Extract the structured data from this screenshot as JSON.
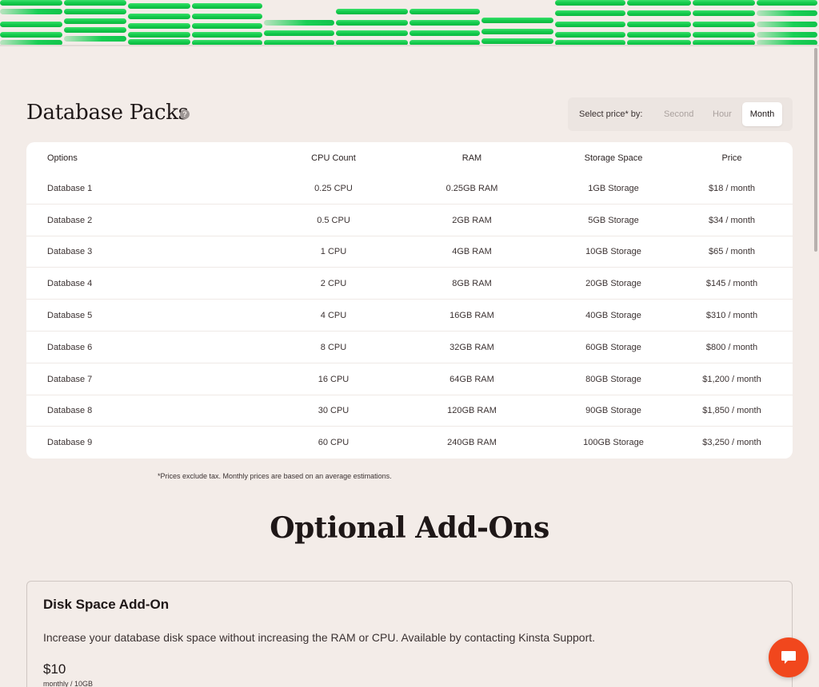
{
  "section": {
    "title": "Database Packs",
    "help_icon": "question-icon",
    "price_toggle": {
      "label": "Select price* by:",
      "options": [
        "Second",
        "Hour",
        "Month"
      ],
      "selected": "Month"
    }
  },
  "table": {
    "headers": [
      "Options",
      "CPU Count",
      "RAM",
      "Storage Space",
      "Price"
    ],
    "rows": [
      [
        "Database 1",
        "0.25 CPU",
        "0.25GB RAM",
        "1GB Storage",
        "$18 / month"
      ],
      [
        "Database 2",
        "0.5 CPU",
        "2GB RAM",
        "5GB Storage",
        "$34 / month"
      ],
      [
        "Database 3",
        "1 CPU",
        "4GB RAM",
        "10GB Storage",
        "$65 / month"
      ],
      [
        "Database 4",
        "2 CPU",
        "8GB RAM",
        "20GB Storage",
        "$145 / month"
      ],
      [
        "Database 5",
        "4 CPU",
        "16GB RAM",
        "40GB Storage",
        "$310 / month"
      ],
      [
        "Database 6",
        "8 CPU",
        "32GB RAM",
        "60GB Storage",
        "$800 / month"
      ],
      [
        "Database 7",
        "16 CPU",
        "64GB RAM",
        "80GB Storage",
        "$1,200 / month"
      ],
      [
        "Database 8",
        "30 CPU",
        "120GB RAM",
        "90GB Storage",
        "$1,850 / month"
      ],
      [
        "Database 9",
        "60 CPU",
        "240GB RAM",
        "100GB Storage",
        "$3,250 / month"
      ]
    ]
  },
  "footnote": "*Prices exclude tax. Monthly prices are based on an average estimations.",
  "addons": {
    "title": "Optional Add-Ons",
    "disk_space": {
      "title": "Disk Space Add-On",
      "description": "Increase your database disk space without increasing the RAM or CPU. Available by contacting Kinsta Support.",
      "price": "$10",
      "unit": "monthly / 10GB"
    }
  },
  "chat": {
    "icon": "chat-bubble-icon"
  },
  "colors": {
    "background": "#f3ece8",
    "accent_green": "#10c94a",
    "chat_orange": "#f1471d"
  }
}
